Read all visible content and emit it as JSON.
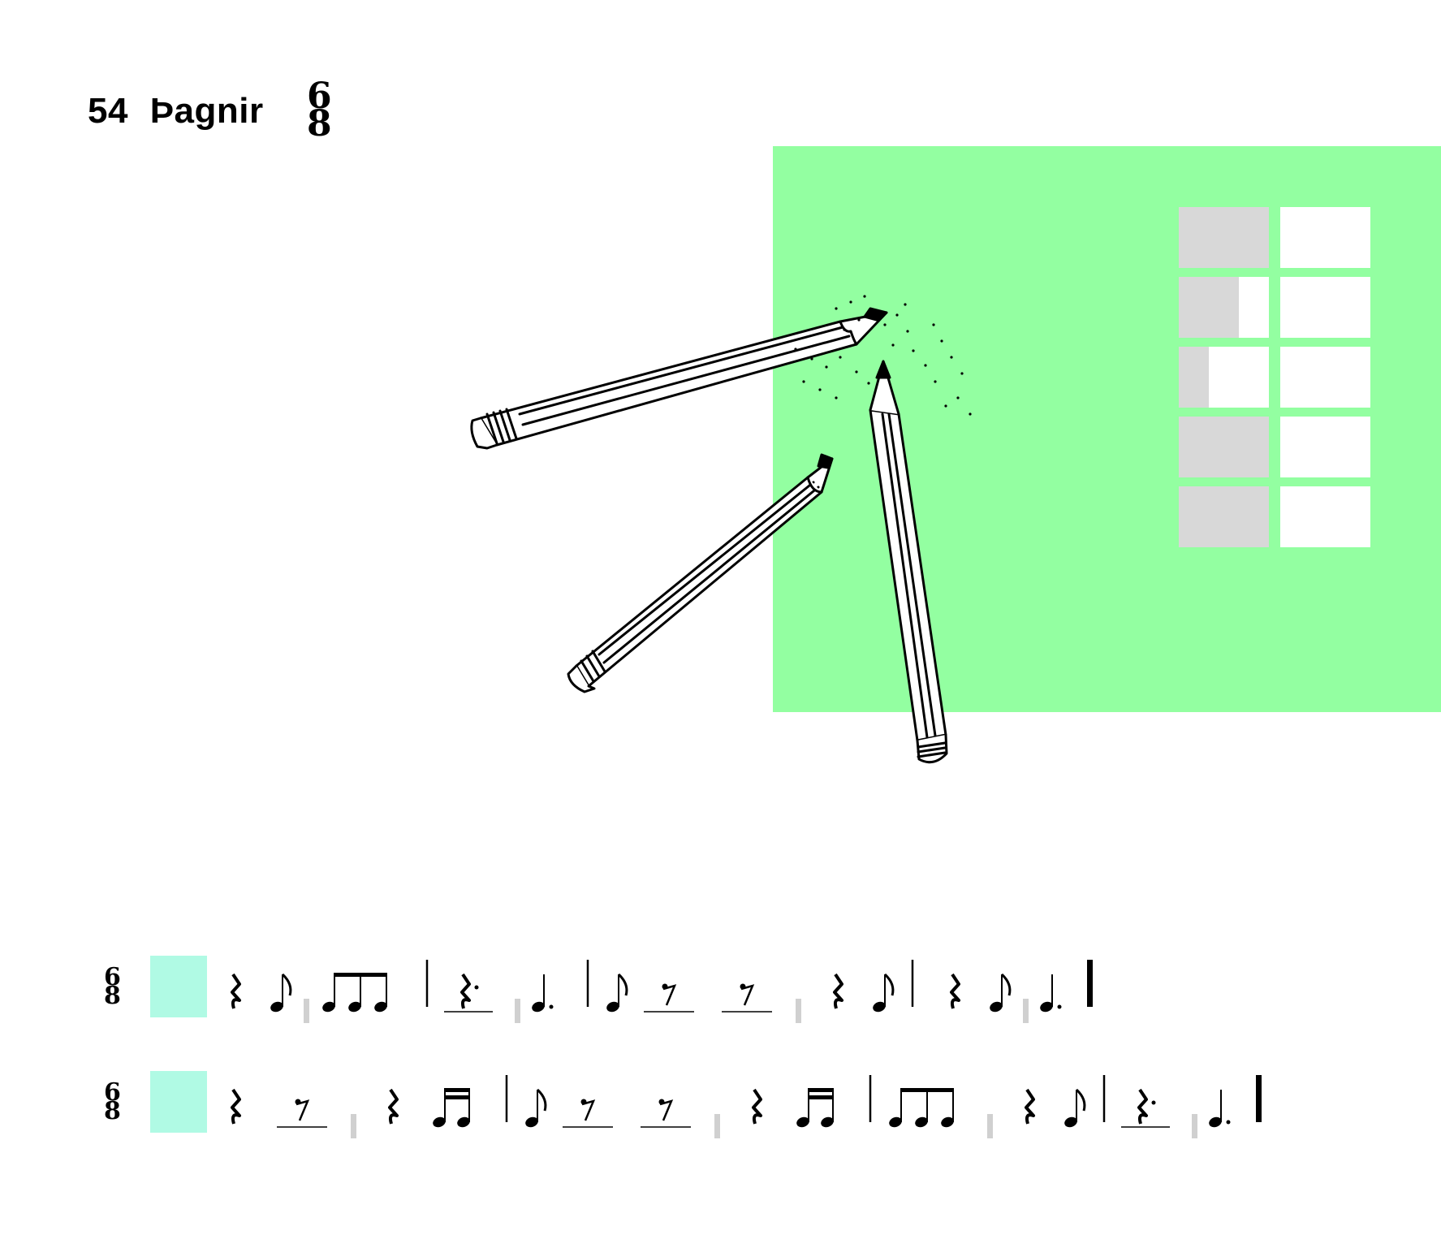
{
  "title": {
    "number": "54",
    "text": "Þagnir",
    "time_sig_top": "6",
    "time_sig_bottom": "8"
  },
  "colors": {
    "panel": "#93ffa1",
    "grid_gray": "#d8d8d8",
    "highlight": "#b0fae4",
    "beat_tick": "#d0d0d0"
  },
  "beat_grid": {
    "rows": [
      [
        "gray",
        "gray",
        "gray",
        "white",
        "white",
        "white"
      ],
      [
        "gray",
        "gray",
        "white",
        "white",
        "white",
        "white"
      ],
      [
        "gray",
        "white",
        "white",
        "white",
        "white",
        "white"
      ],
      [
        "gray",
        "gray",
        "gray",
        "white",
        "white",
        "white"
      ],
      [
        "gray",
        "gray",
        "gray",
        "white",
        "white",
        "white"
      ]
    ]
  },
  "exercises": [
    {
      "time_sig_top": "6",
      "time_sig_bottom": "8",
      "symbols": [
        "quarter-rest",
        "eighth-note",
        "beat-tick",
        "eighth-beam-3",
        "barline",
        "dotted-quarter-rest",
        "beat-tick",
        "dotted-quarter-note",
        "barline",
        "eighth-note",
        "eighth-rest",
        "eighth-rest",
        "beat-tick",
        "quarter-rest",
        "eighth-note",
        "barline",
        "quarter-rest",
        "eighth-note",
        "beat-tick",
        "dotted-quarter-note",
        "final-barline"
      ]
    },
    {
      "time_sig_top": "6",
      "time_sig_bottom": "8",
      "symbols": [
        "quarter-rest",
        "eighth-rest",
        "beat-tick",
        "quarter-rest",
        "sixteenth-pair",
        "barline",
        "eighth-note",
        "eighth-rest",
        "eighth-rest",
        "beat-tick",
        "quarter-rest",
        "sixteenth-pair",
        "barline",
        "eighth-beam-3",
        "beat-tick",
        "quarter-rest",
        "eighth-note",
        "barline",
        "dotted-quarter-rest",
        "beat-tick",
        "dotted-quarter-note",
        "final-barline"
      ]
    }
  ]
}
